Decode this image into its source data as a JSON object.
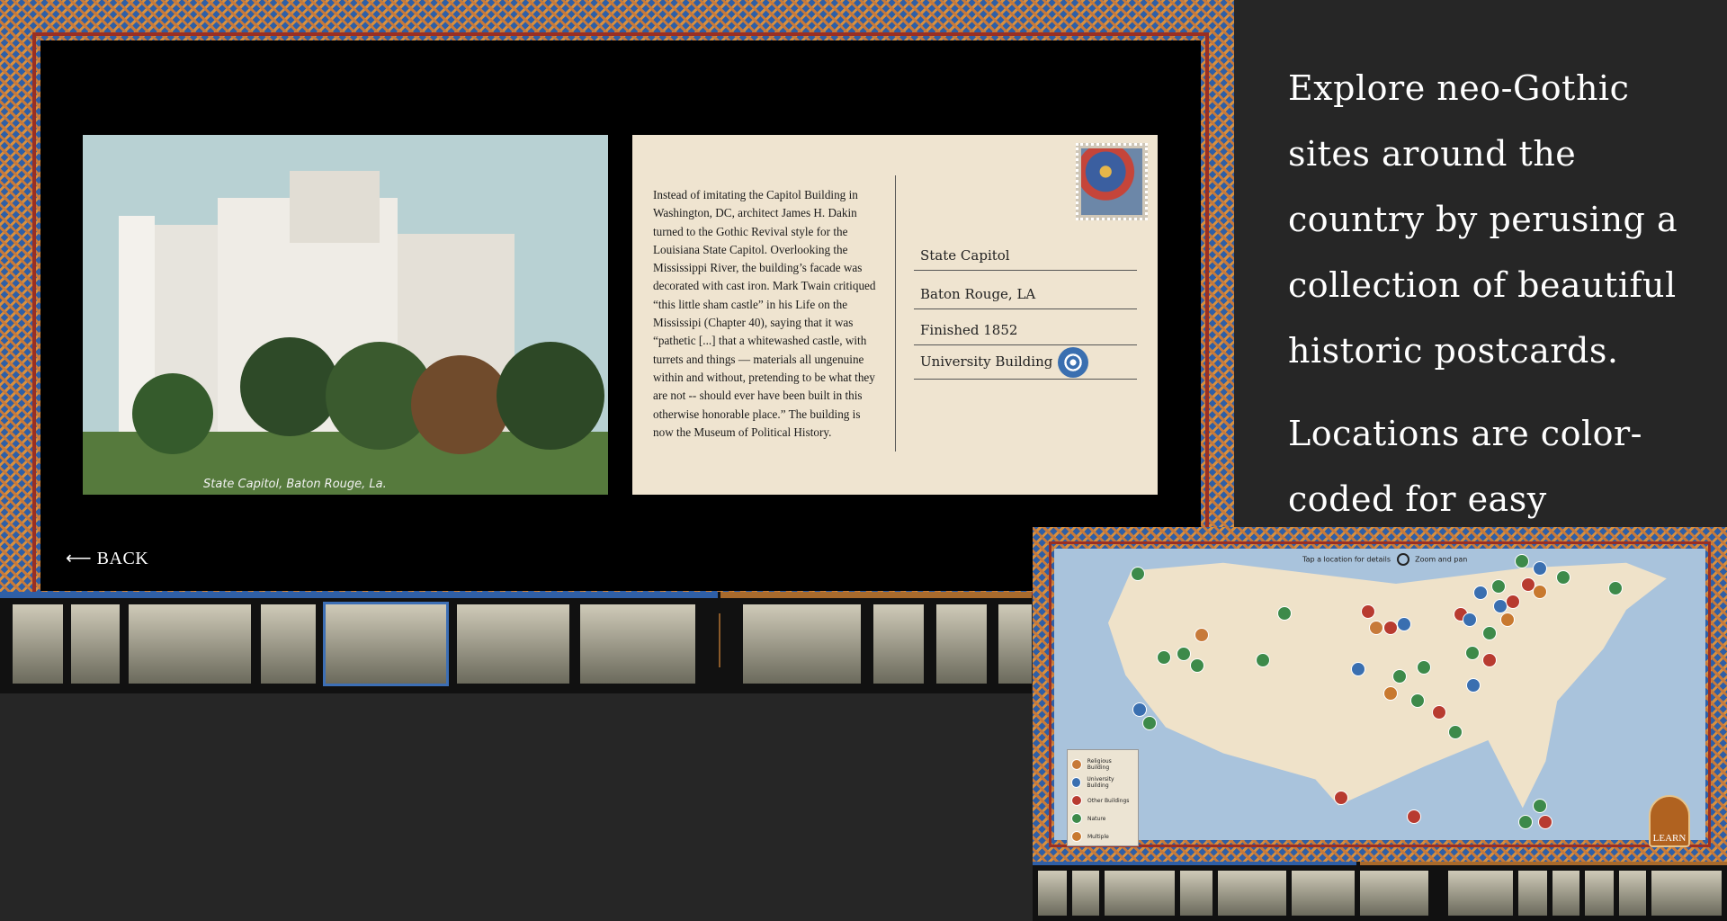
{
  "postcard": {
    "photo_caption": "State Capitol, Baton Rouge, La.",
    "description": "Instead of imitating the Capitol Building in Washington, DC, architect James H. Dakin turned to the Gothic Revival style for the Louisiana State Capitol. Overlooking the Mississippi River, the building’s facade was decorated with cast iron. Mark Twain critiqued “this little sham castle” in his Life on the Mississipi (Chapter 40), saying that it was “pathetic [...] that a whitewashed castle, with turrets and things — materials all ungenuine within and without, pretending to be what they are not -- should ever have been built in this otherwise honorable place.” The building is now the Museum of Political History.",
    "name": "State Capitol",
    "location": "Baton Rouge, LA",
    "finished": "Finished 1852",
    "category": "University Building",
    "stamp_icon": "stamp-icon",
    "category_icon": "rosette-icon"
  },
  "nav": {
    "back_label": "⟵ BACK"
  },
  "intro": {
    "paragraph1": "Explore neo-Gothic sites around the country by perusing a collection of beautiful historic postcards.",
    "paragraph2": "Locations are color-coded for easy interpretation."
  },
  "map": {
    "header_hint": "Tap a location for details",
    "zoom_hint": "Zoom and pan",
    "learn_label": "LEARN",
    "legend": [
      {
        "label": "Religious Building",
        "color": "#c77a3a"
      },
      {
        "label": "University Building",
        "color": "#3a6fb0"
      },
      {
        "label": "Other Buildings",
        "color": "#b83b30"
      },
      {
        "label": "Nature",
        "color": "#3d8a4a"
      },
      {
        "label": "Multiple",
        "color": "#c8792f"
      }
    ]
  },
  "colors": {
    "border_blue": "#2f5fa6",
    "border_orange": "#c87a3a",
    "border_red": "#9a2f23",
    "postcard_paper": "#efe4d0",
    "selected": "#3d6fb5"
  }
}
